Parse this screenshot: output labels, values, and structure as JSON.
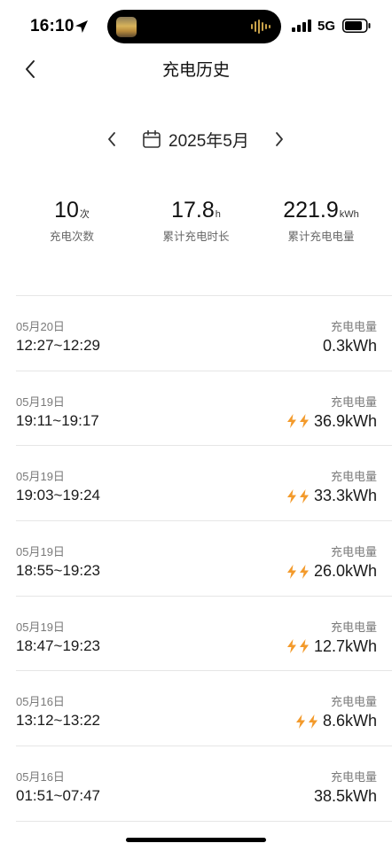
{
  "status_bar": {
    "time": "16:10",
    "network": "5G"
  },
  "nav": {
    "title": "充电历史"
  },
  "month_selector": {
    "label": "2025年5月"
  },
  "summary": {
    "count": {
      "value": "10",
      "unit": "次",
      "label": "充电次数"
    },
    "duration": {
      "value": "17.8",
      "unit": "h",
      "label": "累计充电时长"
    },
    "energy": {
      "value": "221.9",
      "unit": "kWh",
      "label": "累计充电电量"
    }
  },
  "records": [
    {
      "date": "05月20日",
      "time_range": "12:27~12:29",
      "energy_label": "充电电量",
      "energy": "0.3kWh",
      "fast": false
    },
    {
      "date": "05月19日",
      "time_range": "19:11~19:17",
      "energy_label": "充电电量",
      "energy": "36.9kWh",
      "fast": true
    },
    {
      "date": "05月19日",
      "time_range": "19:03~19:24",
      "energy_label": "充电电量",
      "energy": "33.3kWh",
      "fast": true
    },
    {
      "date": "05月19日",
      "time_range": "18:55~19:23",
      "energy_label": "充电电量",
      "energy": "26.0kWh",
      "fast": true
    },
    {
      "date": "05月19日",
      "time_range": "18:47~19:23",
      "energy_label": "充电电量",
      "energy": "12.7kWh",
      "fast": true
    },
    {
      "date": "05月16日",
      "time_range": "13:12~13:22",
      "energy_label": "充电电量",
      "energy": "8.6kWh",
      "fast": true
    },
    {
      "date": "05月16日",
      "time_range": "01:51~07:47",
      "energy_label": "充电电量",
      "energy": "38.5kWh",
      "fast": false
    }
  ],
  "colors": {
    "bolt": "#f39a2b",
    "divider": "#e6e6e6",
    "secondary_text": "#7a7a7a"
  },
  "icons": {
    "back": "chevron-left-icon",
    "prev_month": "chevron-left-icon",
    "next_month": "chevron-right-icon",
    "calendar": "calendar-icon",
    "fast_charge": "lightning-bolt-icon"
  }
}
